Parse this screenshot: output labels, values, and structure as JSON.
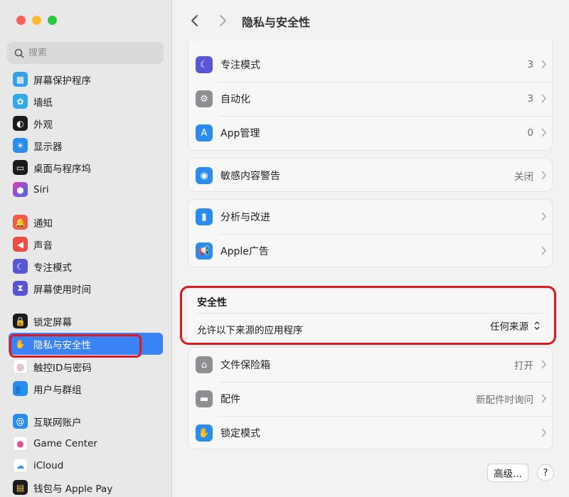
{
  "window": {
    "title": "隐私与安全性"
  },
  "search": {
    "placeholder": "搜索"
  },
  "sidebar": {
    "items": [
      {
        "label": "屏幕保护程序",
        "icon": "screensaver-icon",
        "color": "#35a0e8"
      },
      {
        "label": "墙纸",
        "icon": "wallpaper-icon",
        "color": "#2fa9e7"
      },
      {
        "label": "外观",
        "icon": "appearance-icon",
        "color": "#1c1c1e"
      },
      {
        "label": "显示器",
        "icon": "display-icon",
        "color": "#2b8cf0"
      },
      {
        "label": "桌面与程序坞",
        "icon": "dock-icon",
        "color": "#1c1c1e"
      },
      {
        "label": "Siri",
        "icon": "siri-icon",
        "color": "#6b3fd6"
      },
      {
        "label": "通知",
        "icon": "notification-icon",
        "color": "#f05a4b"
      },
      {
        "label": "声音",
        "icon": "sound-icon",
        "color": "#ee4b46"
      },
      {
        "label": "专注模式",
        "icon": "focus-moon-icon",
        "color": "#5856d6"
      },
      {
        "label": "屏幕使用时间",
        "icon": "hourglass-icon",
        "color": "#5b55d6"
      },
      {
        "label": "锁定屏幕",
        "icon": "lock-screen-icon",
        "color": "#1c1c1e"
      },
      {
        "label": "隐私与安全性",
        "icon": "hand-icon",
        "color": "#3a83f7"
      },
      {
        "label": "触控ID与密码",
        "icon": "fingerprint-icon",
        "color": "#ffffff"
      },
      {
        "label": "用户与群组",
        "icon": "users-icon",
        "color": "#2b8cf0"
      },
      {
        "label": "互联网账户",
        "icon": "at-icon",
        "color": "#2b8cf0"
      },
      {
        "label": "Game Center",
        "icon": "game-center-icon",
        "color": "#ffffff"
      },
      {
        "label": "iCloud",
        "icon": "icloud-icon",
        "color": "#ffffff"
      },
      {
        "label": "钱包与 Apple Pay",
        "icon": "wallet-icon",
        "color": "#1c1c1e"
      }
    ]
  },
  "main": {
    "group1": [
      {
        "label": "专注模式",
        "value": "3",
        "icon": "focus-moon-icon",
        "color": "#5856d6"
      },
      {
        "label": "自动化",
        "value": "3",
        "icon": "gears-icon",
        "color": "#8e8e93"
      },
      {
        "label": "App管理",
        "value": "0",
        "icon": "app-store-icon",
        "color": "#2b8cf0"
      }
    ],
    "group2": [
      {
        "label": "敏感内容警告",
        "value": "关闭",
        "icon": "eye-warning-icon",
        "color": "#2b8cf0"
      }
    ],
    "group3": [
      {
        "label": "分析与改进",
        "value": "",
        "icon": "analytics-icon",
        "color": "#2b8cf0"
      },
      {
        "label": "Apple广告",
        "value": "",
        "icon": "megaphone-icon",
        "color": "#2b8cf0"
      }
    ],
    "security": {
      "title": "安全性",
      "allow_label": "允许以下来源的应用程序",
      "allow_value": "任何来源"
    },
    "group4": [
      {
        "label": "文件保险箱",
        "value": "打开",
        "icon": "filevault-icon",
        "color": "#8e8e93"
      },
      {
        "label": "配件",
        "value": "新配件时询问",
        "icon": "accessory-icon",
        "color": "#8e8e93"
      },
      {
        "label": "锁定模式",
        "value": "",
        "icon": "hand-icon",
        "color": "#2b8cf0"
      }
    ],
    "buttons": {
      "advanced": "高级...",
      "help": "?"
    }
  }
}
